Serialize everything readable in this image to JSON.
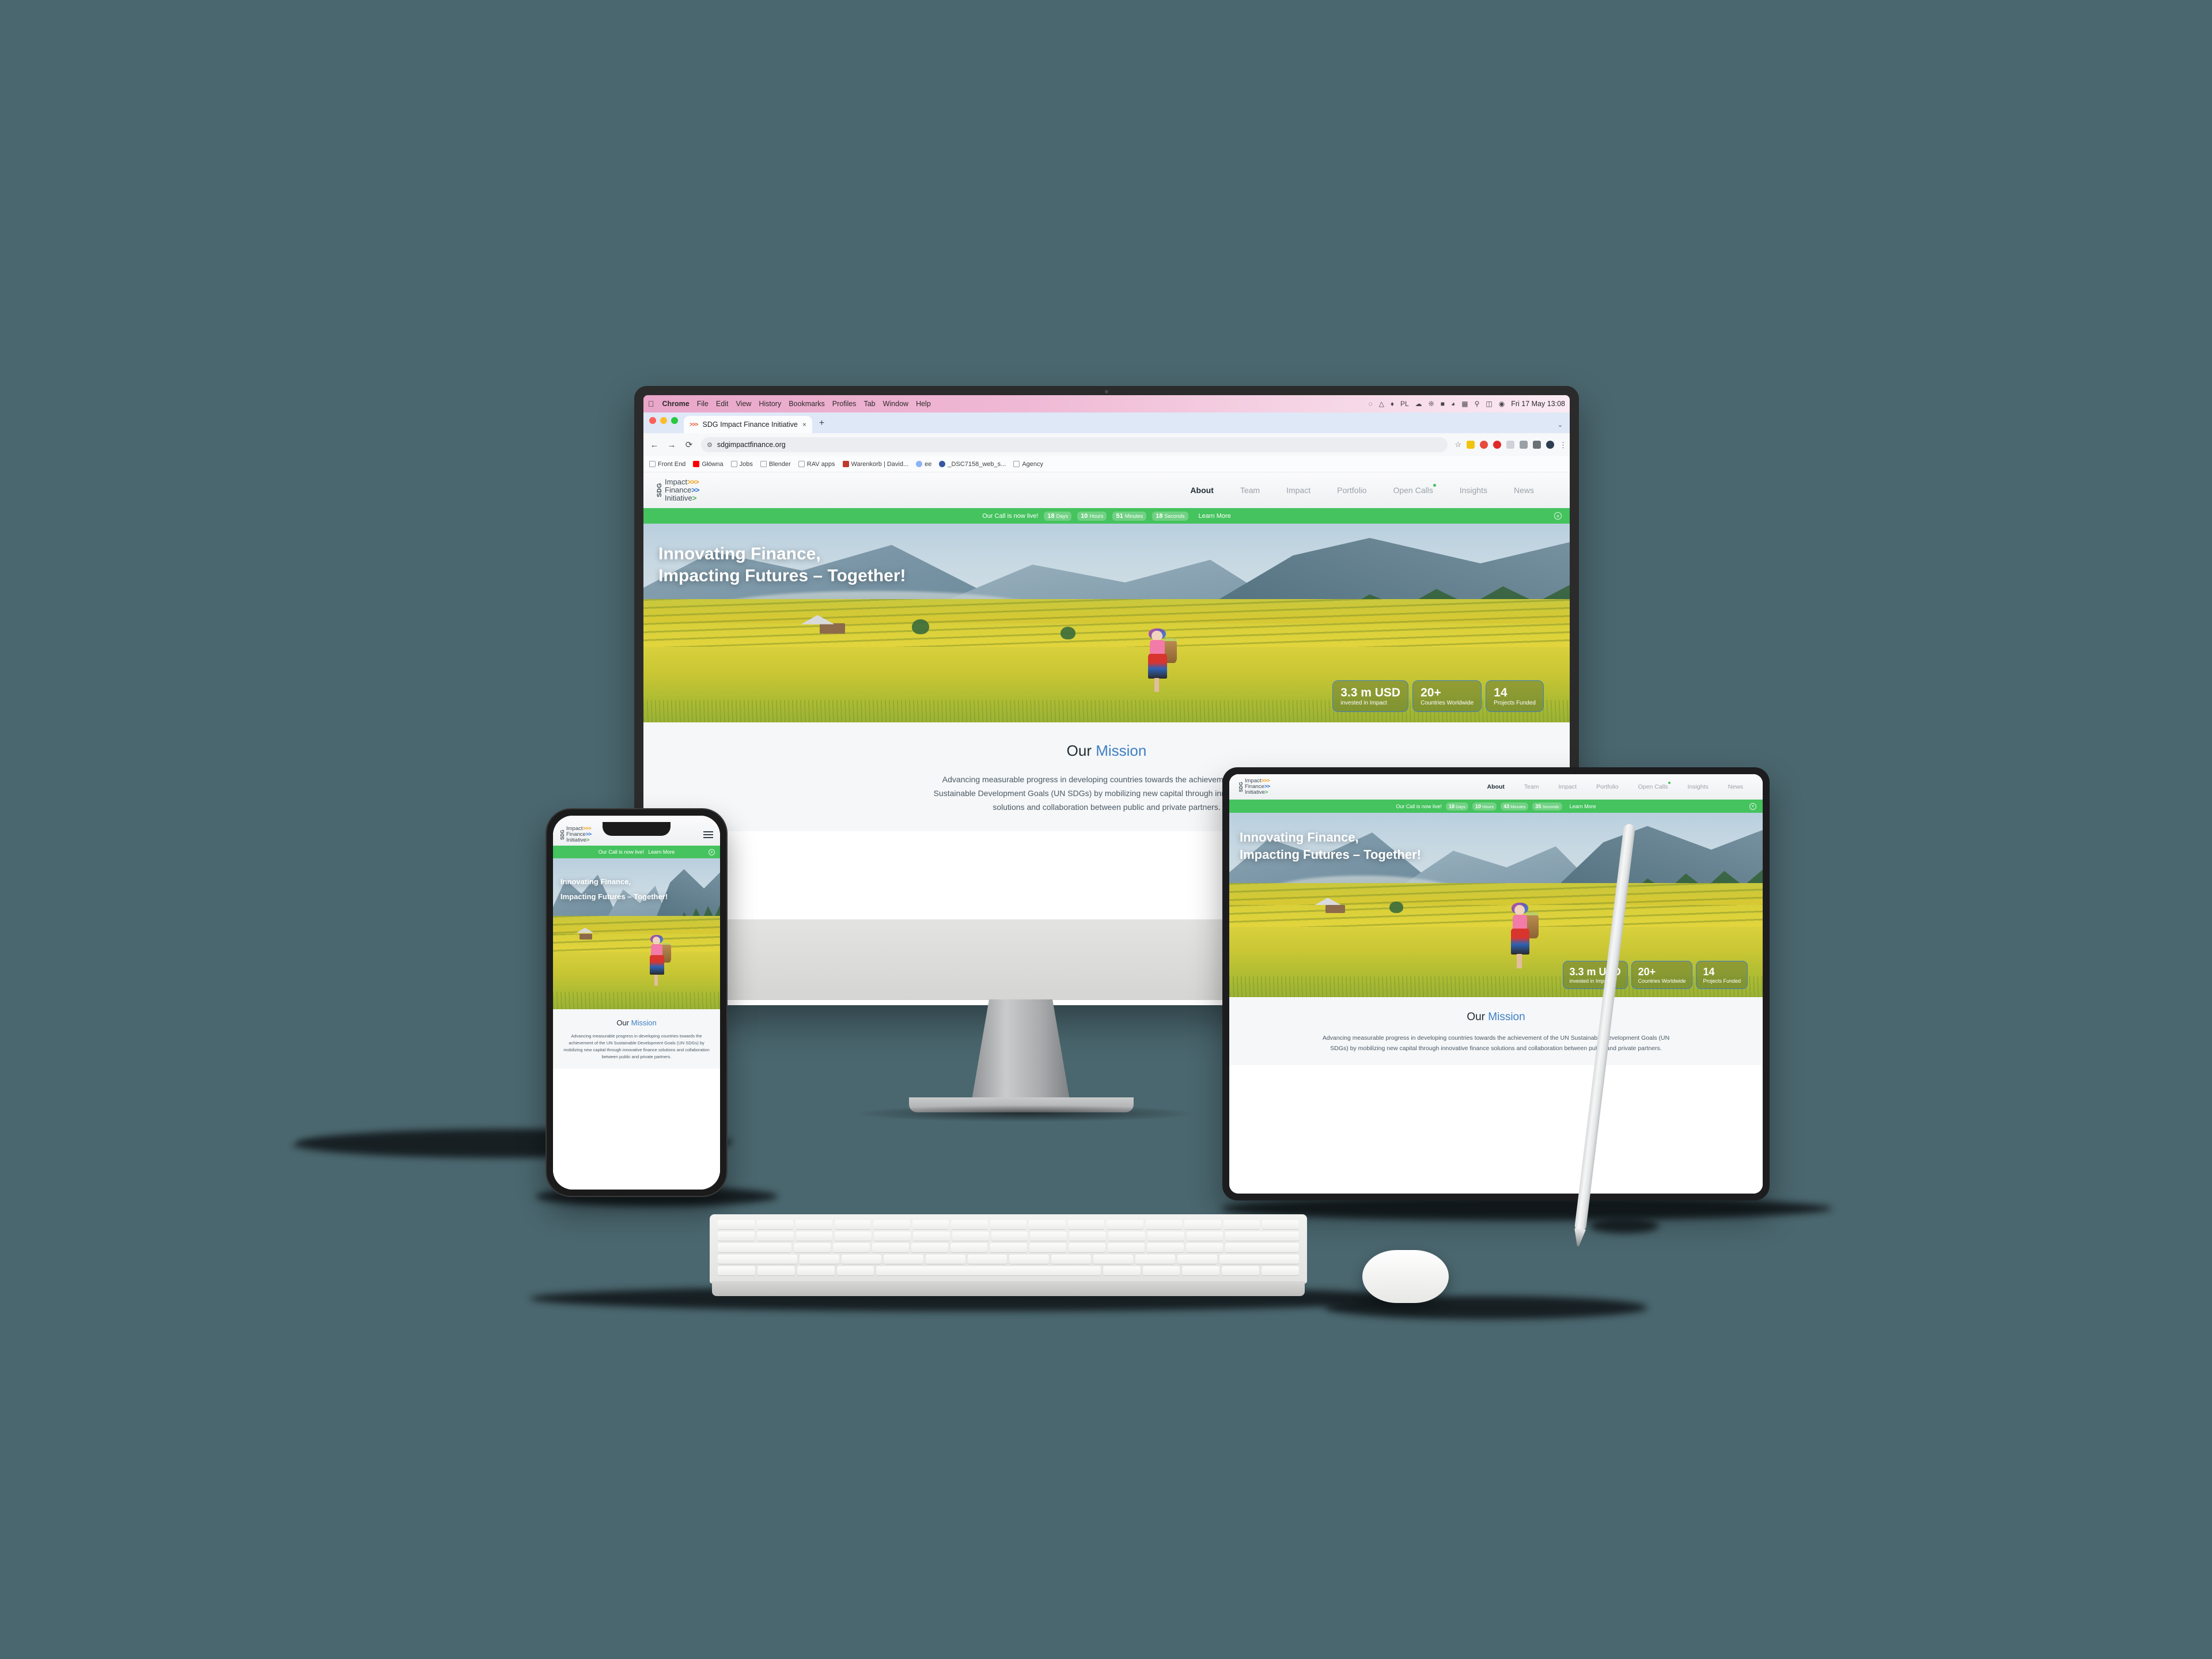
{
  "desktop": {
    "background_color": "#4a666e"
  },
  "macos": {
    "apple_menu": "",
    "menu_items": [
      "Chrome",
      "File",
      "Edit",
      "View",
      "History",
      "Bookmarks",
      "Profiles",
      "Tab",
      "Window",
      "Help"
    ],
    "status_icons": [
      "creative-cloud-icon",
      "dropbox-icon",
      "todo-badge-icon",
      "keyboard-layout-pl-icon",
      "cloud-alert-icon",
      "bluetooth-icon",
      "battery-charging-icon",
      "wifi-icon",
      "control-center-icon",
      "spotlight-search-icon",
      "screen-mirror-icon",
      "siri-icon"
    ],
    "keyboard_layout": "PL",
    "clock": "Fri 17 May  13:08"
  },
  "browser": {
    "tab_title": "SDG Impact Finance Initiative",
    "tab_favicon": "chevrons-icon",
    "tab_close": "×",
    "new_tab": "+",
    "tab_list_caret": "⌄",
    "back": "←",
    "forward": "→",
    "reload": "⟳",
    "site_info_icon": "site-settings-icon",
    "url": "sdgimpactfinance.org",
    "bookmark_star": "☆",
    "toolbar_icons": [
      "color-palette-icon",
      "ad-blocker-icon",
      "password-manager-icon",
      "clipboard-icon",
      "cast-icon",
      "downloads-icon",
      "profile-avatar-icon",
      "chrome-menu-icon"
    ],
    "bookmarks": [
      {
        "label": "Front End",
        "icon": "folder-icon"
      },
      {
        "label": "Główna",
        "icon": "youtube-icon"
      },
      {
        "label": "Jobs",
        "icon": "folder-icon"
      },
      {
        "label": "Blender",
        "icon": "folder-icon"
      },
      {
        "label": "RAV apps",
        "icon": "folder-icon"
      },
      {
        "label": "Warenkorb | David...",
        "icon": "cart-icon"
      },
      {
        "label": "ee",
        "icon": "globe-icon"
      },
      {
        "label": "_DSC7158_web_s...",
        "icon": "wordpress-icon"
      },
      {
        "label": "Agency",
        "icon": "folder-icon"
      }
    ]
  },
  "site": {
    "logo": {
      "vertical_mark": "SDG",
      "lines": [
        {
          "word": "Impact",
          "chevrons": ">>>"
        },
        {
          "word": "Finance",
          "chevrons": ">>"
        },
        {
          "word": "Initiative",
          "chevrons": ">"
        }
      ]
    },
    "nav": [
      {
        "label": "About",
        "active": true,
        "badge": false
      },
      {
        "label": "Team",
        "active": false,
        "badge": false
      },
      {
        "label": "Impact",
        "active": false,
        "badge": false
      },
      {
        "label": "Portfolio",
        "active": false,
        "badge": false
      },
      {
        "label": "Open Calls",
        "active": false,
        "badge": true
      },
      {
        "label": "Insights",
        "active": false,
        "badge": false
      },
      {
        "label": "News",
        "active": false,
        "badge": false
      }
    ],
    "mobile_menu_icon": "hamburger-icon",
    "announcement": {
      "message": "Our Call is now live!",
      "cta": "Learn More",
      "close": "×",
      "countdown_desktop": [
        {
          "value": "18",
          "unit": "Days"
        },
        {
          "value": "10",
          "unit": "Hours"
        },
        {
          "value": "51",
          "unit": "Minutes"
        },
        {
          "value": "18",
          "unit": "Seconds"
        }
      ],
      "countdown_tablet": [
        {
          "value": "18",
          "unit": "Days"
        },
        {
          "value": "10",
          "unit": "Hours"
        },
        {
          "value": "43",
          "unit": "Minutes"
        },
        {
          "value": "35",
          "unit": "Seconds"
        }
      ]
    },
    "hero": {
      "headline_line1": "Innovating Finance,",
      "headline_line2": "Impacting Futures – Together!",
      "image_alt": "terraced-rice-field-photo"
    },
    "stats": [
      {
        "value": "3.3 m USD",
        "label": "invested in Impact"
      },
      {
        "value": "20+",
        "label": "Countries Worldwide"
      },
      {
        "value": "14",
        "label": "Projects Funded"
      }
    ],
    "mission": {
      "title_plain": "Our",
      "title_accent": "Mission",
      "body": "Advancing measurable progress in developing countries towards the achievement of the UN Sustainable Development Goals (UN SDGs) by mobilizing new capital through innovative finance solutions and collaboration between public and private partners."
    },
    "colors": {
      "announcement_green": "#45c35e",
      "accent_blue": "#3f7fc4",
      "mission_background": "#f5f7f9",
      "nav_background": "#eef0f2"
    }
  },
  "devices": {
    "desktop_label": "imac-display",
    "phone_label": "iphone",
    "tablet_label": "ipad",
    "accessories": [
      "magic-keyboard",
      "magic-mouse",
      "apple-pencil"
    ]
  }
}
